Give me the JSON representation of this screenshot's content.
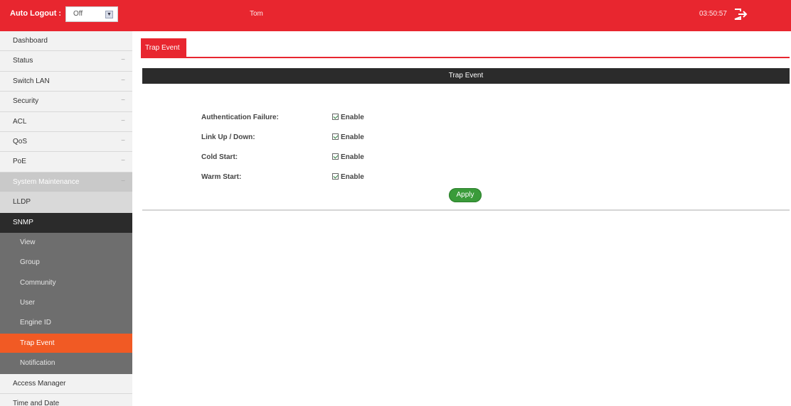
{
  "topbar": {
    "auto_logout_label": "Auto Logout :",
    "auto_logout_value": "Off",
    "user": "Tom",
    "time": "03:50:57"
  },
  "sidebar": {
    "items": [
      {
        "label": "Dashboard"
      },
      {
        "label": "Status"
      },
      {
        "label": "Switch LAN"
      },
      {
        "label": "Security"
      },
      {
        "label": "ACL"
      },
      {
        "label": "QoS"
      },
      {
        "label": "PoE"
      },
      {
        "label": "System Maintenance"
      },
      {
        "label": "LLDP"
      },
      {
        "label": "SNMP"
      },
      {
        "label": "View"
      },
      {
        "label": "Group"
      },
      {
        "label": "Community"
      },
      {
        "label": "User"
      },
      {
        "label": "Engine ID"
      },
      {
        "label": "Trap Event"
      },
      {
        "label": "Notification"
      },
      {
        "label": "Access Manager"
      },
      {
        "label": "Time and Date"
      }
    ]
  },
  "main": {
    "tab": "Trap Event",
    "header": "Trap Event",
    "rows": [
      {
        "label": "Authentication Failure:",
        "value": "Enable"
      },
      {
        "label": "Link Up / Down:",
        "value": "Enable"
      },
      {
        "label": "Cold Start:",
        "value": "Enable"
      },
      {
        "label": "Warm Start:",
        "value": "Enable"
      }
    ],
    "apply_label": "Apply"
  }
}
